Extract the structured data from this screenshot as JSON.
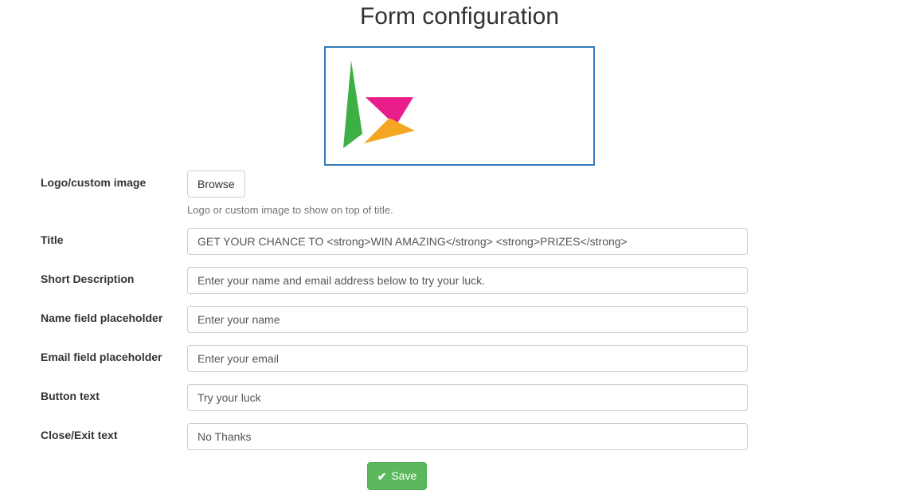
{
  "page_title": "Form configuration",
  "logo_section": {
    "label": "Logo/custom image",
    "browse_label": "Browse",
    "help_text": "Logo or custom image to show on top of title."
  },
  "fields": {
    "title": {
      "label": "Title",
      "value": "GET YOUR CHANCE TO <strong>WIN AMAZING</strong> <strong>PRIZES</strong>"
    },
    "short_description": {
      "label": "Short Description",
      "value": "Enter your name and email address below to try your luck."
    },
    "name_placeholder": {
      "label": "Name field placeholder",
      "value": "Enter your name"
    },
    "email_placeholder": {
      "label": "Email field placeholder",
      "value": "Enter your email"
    },
    "button_text": {
      "label": "Button text",
      "value": "Try your luck"
    },
    "close_text": {
      "label": "Close/Exit text",
      "value": "No Thanks"
    }
  },
  "save_label": "Save"
}
